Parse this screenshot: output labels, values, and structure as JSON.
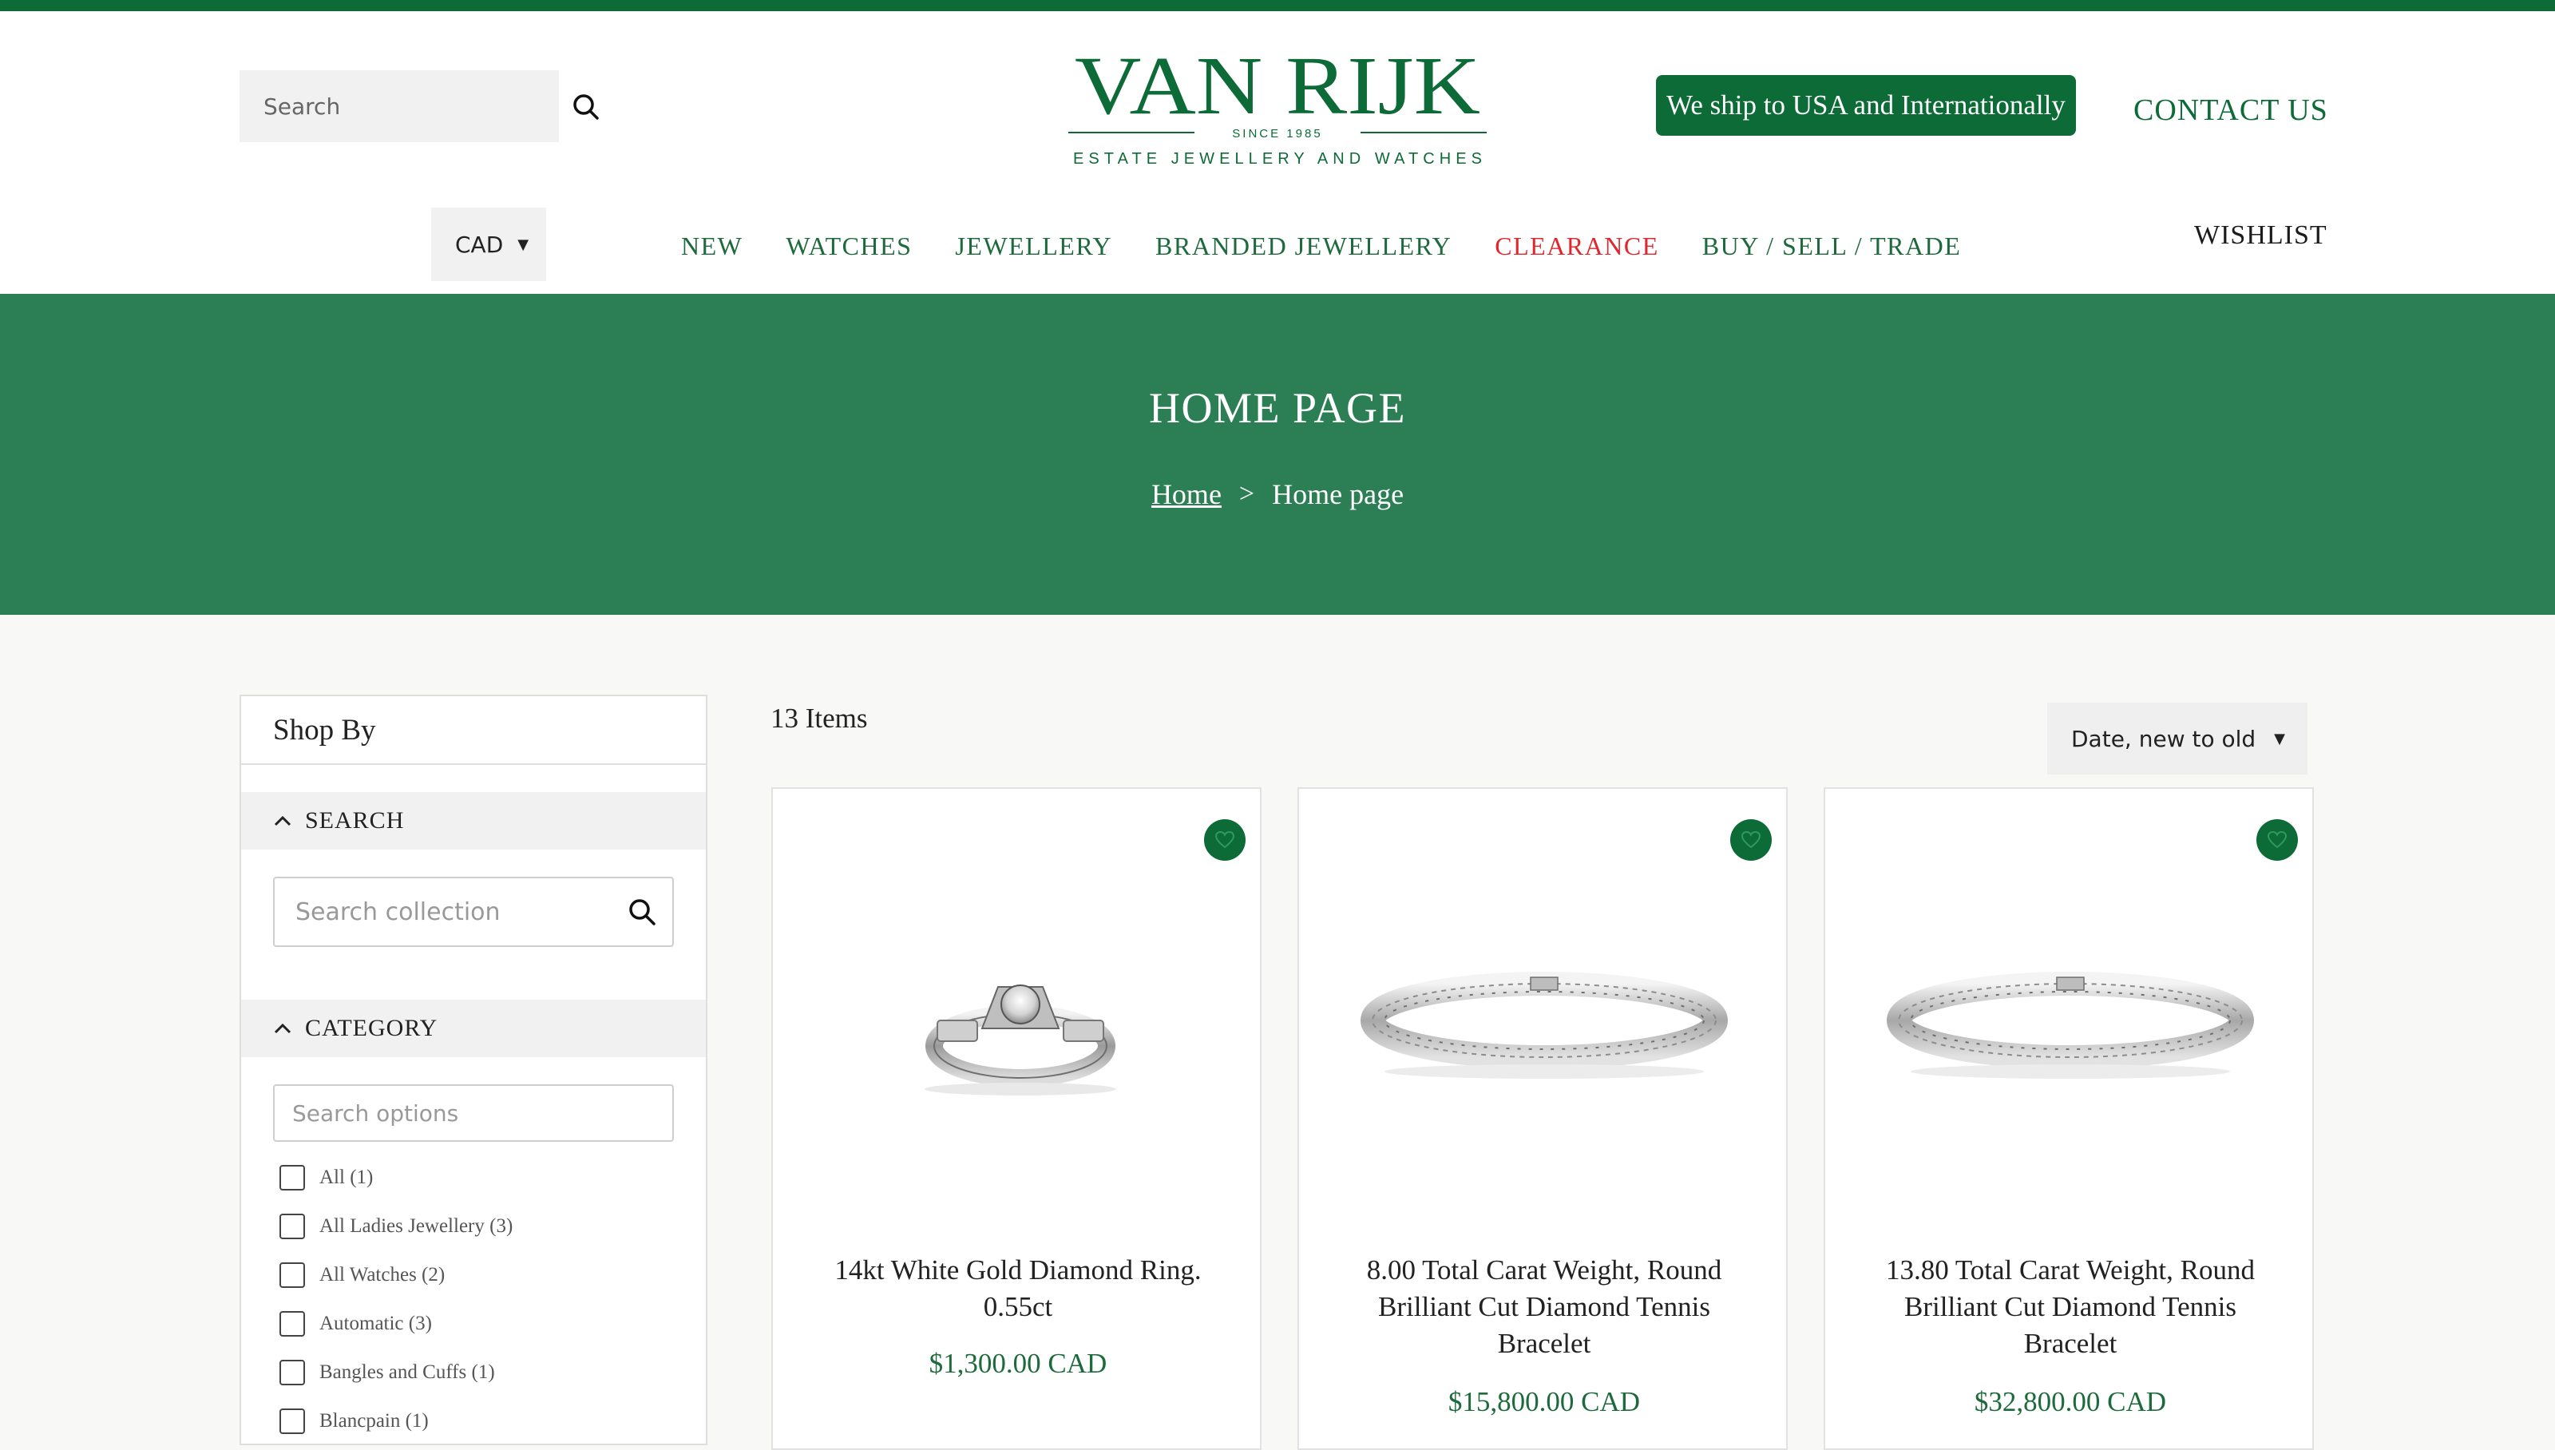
{
  "header": {
    "search_placeholder": "Search",
    "logo": {
      "name": "VAN RIJK",
      "since": "SINCE 1985",
      "tagline": "ESTATE JEWELLERY AND WATCHES"
    },
    "ship_badge": "We ship to USA and Internationally",
    "contact": "CONTACT US",
    "currency": "CAD",
    "wishlist": "WISHLIST"
  },
  "nav": [
    "NEW",
    "WATCHES",
    "JEWELLERY",
    "BRANDED JEWELLERY",
    "CLEARANCE",
    "BUY / SELL / TRADE"
  ],
  "banner": {
    "title": "HOME PAGE",
    "breadcrumb": {
      "home": "Home",
      "separator": ">",
      "current": "Home page"
    }
  },
  "sidebar": {
    "title": "Shop By",
    "search_facet": {
      "label": "SEARCH",
      "placeholder": "Search collection"
    },
    "category_facet": {
      "label": "CATEGORY",
      "placeholder": "Search options",
      "options": [
        "All (1)",
        "All Ladies Jewellery (3)",
        "All Watches (2)",
        "Automatic (3)",
        "Bangles and Cuffs (1)",
        "Blancpain (1)"
      ]
    }
  },
  "results": {
    "count": "13 Items",
    "sort": "Date, new to old",
    "products": [
      {
        "name": "14kt White Gold Diamond Ring. 0.55ct",
        "price": "$1,300.00 CAD"
      },
      {
        "name": "8.00 Total Carat Weight, Round Brilliant Cut Diamond Tennis Bracelet",
        "price": "$15,800.00 CAD"
      },
      {
        "name": "13.80 Total Carat Weight, Round Brilliant Cut Diamond Tennis Bracelet",
        "price": "$32,800.00 CAD"
      }
    ]
  },
  "colors": {
    "brand_green": "#0c6b36",
    "banner_green": "#2c7e55",
    "clearance_red": "#e1262d"
  },
  "icons": [
    "search-icon",
    "caret-down-icon",
    "chevron-up-icon",
    "heart-icon"
  ]
}
